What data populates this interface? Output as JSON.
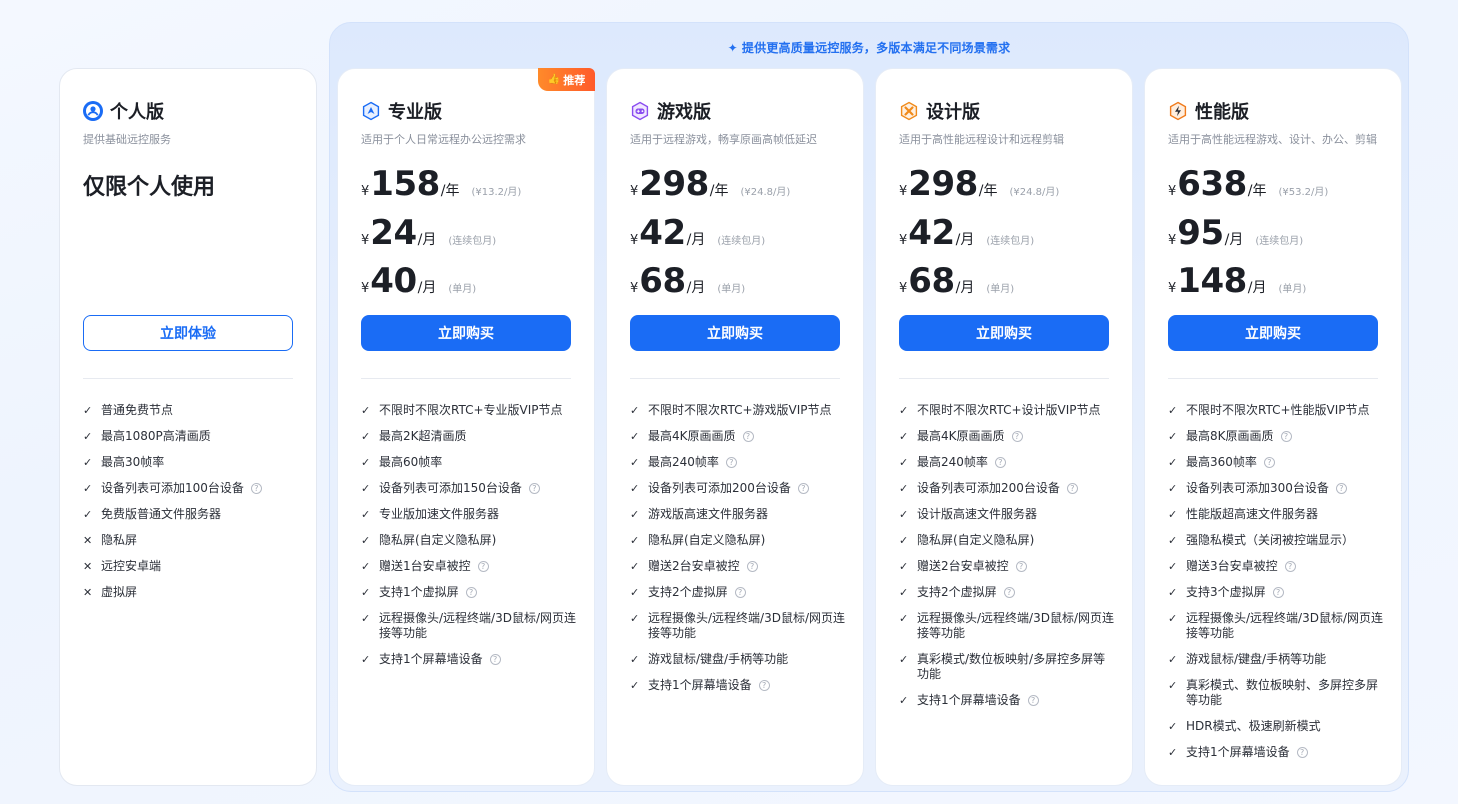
{
  "banner": "提供更高质量远控服务，多版本满足不同场景需求",
  "colors": {
    "accent": "#1a6cf5",
    "badge": "#ff6a2a"
  },
  "plans": [
    {
      "title": "个人版",
      "icon": "user-icon",
      "subtitle": "提供基础远控服务",
      "headline": "仅限个人使用",
      "button": "立即体验",
      "features": [
        {
          "mark": "check",
          "text": "普通免费节点",
          "help": false
        },
        {
          "mark": "check",
          "text": "最高1080P高清画质",
          "help": false
        },
        {
          "mark": "check",
          "text": "最高30帧率",
          "help": false
        },
        {
          "mark": "check",
          "text": "设备列表可添加100台设备",
          "help": true
        },
        {
          "mark": "check",
          "text": "免费版普通文件服务器",
          "help": false
        },
        {
          "mark": "cross",
          "text": "隐私屏",
          "help": false
        },
        {
          "mark": "cross",
          "text": "远控安卓端",
          "help": false
        },
        {
          "mark": "cross",
          "text": "虚拟屏",
          "help": false
        }
      ]
    },
    {
      "title": "专业版",
      "icon": "pro-icon",
      "badge": "推荐",
      "subtitle": "适用于个人日常远程办公远控需求",
      "prices": [
        {
          "yen": "¥",
          "amount": "158",
          "unit": "/年",
          "note": "(¥13.2/月)"
        },
        {
          "yen": "¥",
          "amount": "24",
          "unit": "/月",
          "note": "(连续包月)"
        },
        {
          "yen": "¥",
          "amount": "40",
          "unit": "/月",
          "note": "(单月)"
        }
      ],
      "button": "立即购买",
      "features": [
        {
          "mark": "check",
          "text": "不限时不限次RTC+专业版VIP节点",
          "help": false
        },
        {
          "mark": "check",
          "text": "最高2K超清画质",
          "help": false
        },
        {
          "mark": "check",
          "text": "最高60帧率",
          "help": false
        },
        {
          "mark": "check",
          "text": "设备列表可添加150台设备",
          "help": true
        },
        {
          "mark": "check",
          "text": "专业版加速文件服务器",
          "help": false
        },
        {
          "mark": "check",
          "text": "隐私屏(自定义隐私屏)",
          "help": false
        },
        {
          "mark": "check",
          "text": "赠送1台安卓被控",
          "help": true
        },
        {
          "mark": "check",
          "text": "支持1个虚拟屏",
          "help": true
        },
        {
          "mark": "check",
          "text": "远程摄像头/远程终端/3D鼠标/网页连接等功能",
          "help": false
        },
        {
          "mark": "check",
          "text": "支持1个屏幕墙设备",
          "help": true
        }
      ]
    },
    {
      "title": "游戏版",
      "icon": "gamepad-icon",
      "subtitle": "适用于远程游戏，畅享原画高帧低延迟",
      "prices": [
        {
          "yen": "¥",
          "amount": "298",
          "unit": "/年",
          "note": "(¥24.8/月)"
        },
        {
          "yen": "¥",
          "amount": "42",
          "unit": "/月",
          "note": "(连续包月)"
        },
        {
          "yen": "¥",
          "amount": "68",
          "unit": "/月",
          "note": "(单月)"
        }
      ],
      "button": "立即购买",
      "features": [
        {
          "mark": "check",
          "text": "不限时不限次RTC+游戏版VIP节点",
          "help": false
        },
        {
          "mark": "check",
          "text": "最高4K原画画质",
          "help": true
        },
        {
          "mark": "check",
          "text": "最高240帧率",
          "help": true
        },
        {
          "mark": "check",
          "text": "设备列表可添加200台设备",
          "help": true
        },
        {
          "mark": "check",
          "text": "游戏版高速文件服务器",
          "help": false
        },
        {
          "mark": "check",
          "text": "隐私屏(自定义隐私屏)",
          "help": false
        },
        {
          "mark": "check",
          "text": "赠送2台安卓被控",
          "help": true
        },
        {
          "mark": "check",
          "text": "支持2个虚拟屏",
          "help": true
        },
        {
          "mark": "check",
          "text": "远程摄像头/远程终端/3D鼠标/网页连接等功能",
          "help": false
        },
        {
          "mark": "check",
          "text": "游戏鼠标/键盘/手柄等功能",
          "help": false
        },
        {
          "mark": "check",
          "text": "支持1个屏幕墙设备",
          "help": true
        }
      ]
    },
    {
      "title": "设计版",
      "icon": "design-icon",
      "subtitle": "适用于高性能远程设计和远程剪辑",
      "prices": [
        {
          "yen": "¥",
          "amount": "298",
          "unit": "/年",
          "note": "(¥24.8/月)"
        },
        {
          "yen": "¥",
          "amount": "42",
          "unit": "/月",
          "note": "(连续包月)"
        },
        {
          "yen": "¥",
          "amount": "68",
          "unit": "/月",
          "note": "(单月)"
        }
      ],
      "button": "立即购买",
      "features": [
        {
          "mark": "check",
          "text": "不限时不限次RTC+设计版VIP节点",
          "help": false
        },
        {
          "mark": "check",
          "text": "最高4K原画画质",
          "help": true
        },
        {
          "mark": "check",
          "text": "最高240帧率",
          "help": true
        },
        {
          "mark": "check",
          "text": "设备列表可添加200台设备",
          "help": true
        },
        {
          "mark": "check",
          "text": "设计版高速文件服务器",
          "help": false
        },
        {
          "mark": "check",
          "text": "隐私屏(自定义隐私屏)",
          "help": false
        },
        {
          "mark": "check",
          "text": "赠送2台安卓被控",
          "help": true
        },
        {
          "mark": "check",
          "text": "支持2个虚拟屏",
          "help": true
        },
        {
          "mark": "check",
          "text": "远程摄像头/远程终端/3D鼠标/网页连接等功能",
          "help": false
        },
        {
          "mark": "check",
          "text": "真彩模式/数位板映射/多屏控多屏等功能",
          "help": false
        },
        {
          "mark": "check",
          "text": "支持1个屏幕墙设备",
          "help": true
        }
      ]
    },
    {
      "title": "性能版",
      "icon": "lightning-icon",
      "subtitle": "适用于高性能远程游戏、设计、办公、剪辑",
      "prices": [
        {
          "yen": "¥",
          "amount": "638",
          "unit": "/年",
          "note": "(¥53.2/月)"
        },
        {
          "yen": "¥",
          "amount": "95",
          "unit": "/月",
          "note": "(连续包月)"
        },
        {
          "yen": "¥",
          "amount": "148",
          "unit": "/月",
          "note": "(单月)"
        }
      ],
      "button": "立即购买",
      "features": [
        {
          "mark": "check",
          "text": "不限时不限次RTC+性能版VIP节点",
          "help": false
        },
        {
          "mark": "check",
          "text": "最高8K原画画质",
          "help": true
        },
        {
          "mark": "check",
          "text": "最高360帧率",
          "help": true
        },
        {
          "mark": "check",
          "text": "设备列表可添加300台设备",
          "help": true
        },
        {
          "mark": "check",
          "text": "性能版超高速文件服务器",
          "help": false
        },
        {
          "mark": "check",
          "text": "强隐私模式（关闭被控端显示）",
          "help": false
        },
        {
          "mark": "check",
          "text": "赠送3台安卓被控",
          "help": true
        },
        {
          "mark": "check",
          "text": "支持3个虚拟屏",
          "help": true
        },
        {
          "mark": "check",
          "text": "远程摄像头/远程终端/3D鼠标/网页连接等功能",
          "help": false
        },
        {
          "mark": "check",
          "text": "游戏鼠标/键盘/手柄等功能",
          "help": false
        },
        {
          "mark": "check",
          "text": "真彩模式、数位板映射、多屏控多屏等功能",
          "help": false
        },
        {
          "mark": "check",
          "text": "HDR模式、极速刷新模式",
          "help": false
        },
        {
          "mark": "check",
          "text": "支持1个屏幕墙设备",
          "help": true
        }
      ]
    }
  ]
}
